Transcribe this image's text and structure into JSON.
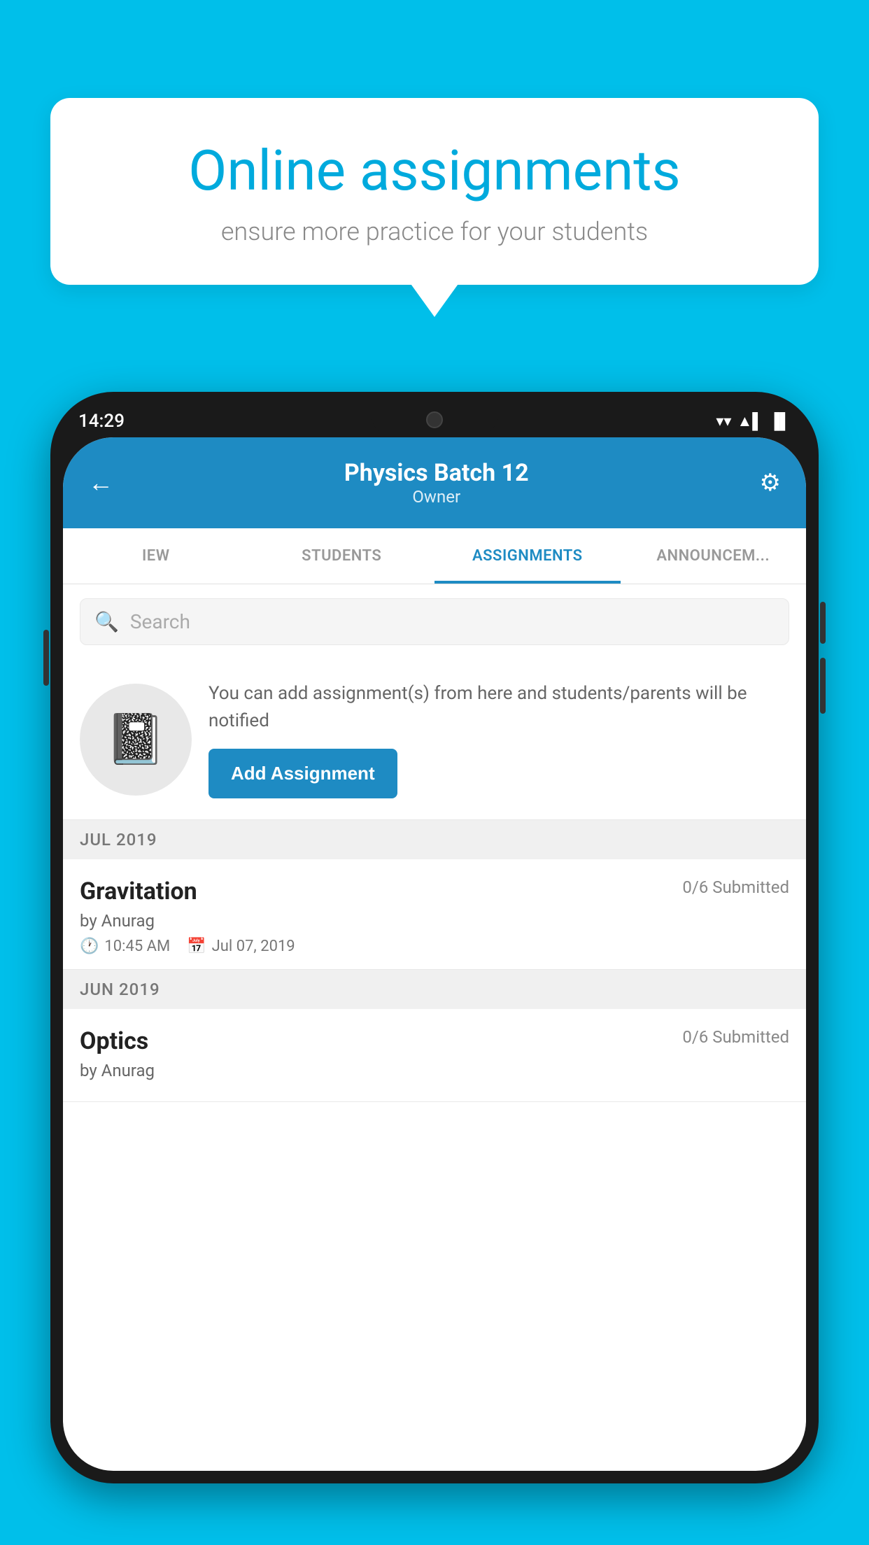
{
  "background": {
    "color": "#00BFEA"
  },
  "speech_bubble": {
    "title": "Online assignments",
    "subtitle": "ensure more practice for your students"
  },
  "status_bar": {
    "time": "14:29",
    "wifi": "▲",
    "signal": "▲",
    "battery": "▐"
  },
  "header": {
    "title": "Physics Batch 12",
    "subtitle": "Owner",
    "back_label": "←",
    "gear_label": "⚙"
  },
  "tabs": [
    {
      "label": "IEW",
      "active": false
    },
    {
      "label": "STUDENTS",
      "active": false
    },
    {
      "label": "ASSIGNMENTS",
      "active": true
    },
    {
      "label": "ANNOUNCEM...",
      "active": false
    }
  ],
  "search": {
    "placeholder": "Search"
  },
  "promo": {
    "icon": "📓",
    "text": "You can add assignment(s) from here and students/parents will be notified",
    "button_label": "Add Assignment"
  },
  "sections": [
    {
      "header": "JUL 2019",
      "assignments": [
        {
          "title": "Gravitation",
          "submitted": "0/6 Submitted",
          "by": "by Anurag",
          "time": "10:45 AM",
          "date": "Jul 07, 2019"
        }
      ]
    },
    {
      "header": "JUN 2019",
      "assignments": [
        {
          "title": "Optics",
          "submitted": "0/6 Submitted",
          "by": "by Anurag",
          "time": "",
          "date": ""
        }
      ]
    }
  ]
}
